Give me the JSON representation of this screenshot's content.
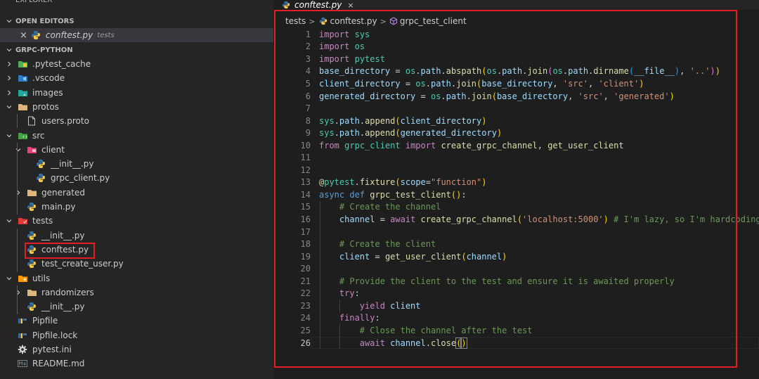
{
  "explorer": {
    "title": "EXPLORER",
    "more": "···",
    "open_editors_label": "OPEN EDITORS",
    "open_editor": {
      "close": "×",
      "name": "conftest.py",
      "folder": "tests"
    },
    "project_label": "GRPC-PYTHON",
    "tree": [
      {
        "label": ".pytest_cache",
        "kind": "folder",
        "expanded": false,
        "icon": "pytest-folder-icon"
      },
      {
        "label": ".vscode",
        "kind": "folder",
        "expanded": false,
        "icon": "vscode-folder-icon"
      },
      {
        "label": "images",
        "kind": "folder",
        "expanded": false,
        "icon": "images-folder-icon"
      },
      {
        "label": "protos",
        "kind": "folder",
        "expanded": true,
        "icon": "folder-icon"
      },
      {
        "label": "users.proto",
        "kind": "file",
        "icon": "file-icon"
      },
      {
        "label": "src",
        "kind": "folder",
        "expanded": true,
        "icon": "src-folder-icon"
      },
      {
        "label": "client",
        "kind": "folder",
        "expanded": true,
        "icon": "client-folder-icon"
      },
      {
        "label": "__init__.py",
        "kind": "file",
        "icon": "python-icon"
      },
      {
        "label": "grpc_client.py",
        "kind": "file",
        "icon": "python-icon"
      },
      {
        "label": "generated",
        "kind": "folder",
        "expanded": false,
        "icon": "folder-icon"
      },
      {
        "label": "main.py",
        "kind": "file",
        "icon": "python-icon"
      },
      {
        "label": "tests",
        "kind": "folder",
        "expanded": true,
        "icon": "tests-folder-icon"
      },
      {
        "label": "__init__.py",
        "kind": "file",
        "icon": "python-icon"
      },
      {
        "label": "conftest.py",
        "kind": "file",
        "icon": "python-icon"
      },
      {
        "label": "test_create_user.py",
        "kind": "file",
        "icon": "python-icon"
      },
      {
        "label": "utils",
        "kind": "folder",
        "expanded": true,
        "icon": "utils-folder-icon"
      },
      {
        "label": "randomizers",
        "kind": "folder",
        "expanded": false,
        "icon": "folder-icon"
      },
      {
        "label": "__init__.py",
        "kind": "file",
        "icon": "python-icon"
      },
      {
        "label": "Pipfile",
        "kind": "file",
        "icon": "pipfile-icon"
      },
      {
        "label": "Pipfile.lock",
        "kind": "file",
        "icon": "pipfile-icon"
      },
      {
        "label": "pytest.ini",
        "kind": "file",
        "icon": "gear-icon"
      },
      {
        "label": "README.md",
        "kind": "file",
        "icon": "markdown-icon"
      }
    ]
  },
  "tab": {
    "name": "conftest.py",
    "close": "×"
  },
  "breadcrumb": {
    "folder": "tests",
    "file": "conftest.py",
    "symbol": "grpc_test_client"
  },
  "editor": {
    "active_line": 26,
    "lines": [
      [
        [
          "k-ctrl",
          "import"
        ],
        [
          "k-pl",
          " "
        ],
        [
          "k-cls",
          "sys"
        ]
      ],
      [
        [
          "k-ctrl",
          "import"
        ],
        [
          "k-pl",
          " "
        ],
        [
          "k-cls",
          "os"
        ]
      ],
      [
        [
          "k-ctrl",
          "import"
        ],
        [
          "k-pl",
          " "
        ],
        [
          "k-cls",
          "pytest"
        ]
      ],
      [
        [
          "k-var",
          "base_directory"
        ],
        [
          "k-pl",
          " = "
        ],
        [
          "k-cls",
          "os"
        ],
        [
          "k-pl",
          "."
        ],
        [
          "k-var",
          "path"
        ],
        [
          "k-pl",
          "."
        ],
        [
          "k-fn",
          "abspath"
        ],
        [
          "k-par",
          "("
        ],
        [
          "k-cls",
          "os"
        ],
        [
          "k-pl",
          "."
        ],
        [
          "k-var",
          "path"
        ],
        [
          "k-pl",
          "."
        ],
        [
          "k-fn",
          "join"
        ],
        [
          "k-par2",
          "("
        ],
        [
          "k-cls",
          "os"
        ],
        [
          "k-pl",
          "."
        ],
        [
          "k-var",
          "path"
        ],
        [
          "k-pl",
          "."
        ],
        [
          "k-fn",
          "dirname"
        ],
        [
          "k-par3",
          "("
        ],
        [
          "k-var",
          "__file__"
        ],
        [
          "k-par3",
          ")"
        ],
        [
          "k-pl",
          ", "
        ],
        [
          "k-str",
          "'..'"
        ],
        [
          "k-par2",
          ")"
        ],
        [
          "k-par",
          ")"
        ]
      ],
      [
        [
          "k-var",
          "client_directory"
        ],
        [
          "k-pl",
          " = "
        ],
        [
          "k-cls",
          "os"
        ],
        [
          "k-pl",
          "."
        ],
        [
          "k-var",
          "path"
        ],
        [
          "k-pl",
          "."
        ],
        [
          "k-fn",
          "join"
        ],
        [
          "k-par",
          "("
        ],
        [
          "k-var",
          "base_directory"
        ],
        [
          "k-pl",
          ", "
        ],
        [
          "k-str",
          "'src'"
        ],
        [
          "k-pl",
          ", "
        ],
        [
          "k-str",
          "'client'"
        ],
        [
          "k-par",
          ")"
        ]
      ],
      [
        [
          "k-var",
          "generated_directory"
        ],
        [
          "k-pl",
          " = "
        ],
        [
          "k-cls",
          "os"
        ],
        [
          "k-pl",
          "."
        ],
        [
          "k-var",
          "path"
        ],
        [
          "k-pl",
          "."
        ],
        [
          "k-fn",
          "join"
        ],
        [
          "k-par",
          "("
        ],
        [
          "k-var",
          "base_directory"
        ],
        [
          "k-pl",
          ", "
        ],
        [
          "k-str",
          "'src'"
        ],
        [
          "k-pl",
          ", "
        ],
        [
          "k-str",
          "'generated'"
        ],
        [
          "k-par",
          ")"
        ]
      ],
      [],
      [
        [
          "k-cls",
          "sys"
        ],
        [
          "k-pl",
          "."
        ],
        [
          "k-var",
          "path"
        ],
        [
          "k-pl",
          "."
        ],
        [
          "k-fn",
          "append"
        ],
        [
          "k-par",
          "("
        ],
        [
          "k-var",
          "client_directory"
        ],
        [
          "k-par",
          ")"
        ]
      ],
      [
        [
          "k-cls",
          "sys"
        ],
        [
          "k-pl",
          "."
        ],
        [
          "k-var",
          "path"
        ],
        [
          "k-pl",
          "."
        ],
        [
          "k-fn",
          "append"
        ],
        [
          "k-par",
          "("
        ],
        [
          "k-var",
          "generated_directory"
        ],
        [
          "k-par",
          ")"
        ]
      ],
      [
        [
          "k-ctrl",
          "from"
        ],
        [
          "k-pl",
          " "
        ],
        [
          "k-cls",
          "grpc_client"
        ],
        [
          "k-pl",
          " "
        ],
        [
          "k-ctrl",
          "import"
        ],
        [
          "k-pl",
          " "
        ],
        [
          "k-fn",
          "create_grpc_channel"
        ],
        [
          "k-pl",
          ", "
        ],
        [
          "k-fn",
          "get_user_client"
        ]
      ],
      [],
      [],
      [
        [
          "k-fn",
          "@"
        ],
        [
          "k-cls",
          "pytest"
        ],
        [
          "k-pl",
          "."
        ],
        [
          "k-fn",
          "fixture"
        ],
        [
          "k-par",
          "("
        ],
        [
          "k-var",
          "scope"
        ],
        [
          "k-pl",
          "="
        ],
        [
          "k-str",
          "\"function\""
        ],
        [
          "k-par",
          ")"
        ]
      ],
      [
        [
          "k-kw",
          "async"
        ],
        [
          "k-pl",
          " "
        ],
        [
          "k-kw",
          "def"
        ],
        [
          "k-pl",
          " "
        ],
        [
          "k-fn",
          "grpc_test_client"
        ],
        [
          "k-par",
          "("
        ],
        [
          "k-par",
          ")"
        ],
        [
          "k-pl",
          ":"
        ]
      ],
      [
        [
          "k-pl",
          "    "
        ],
        [
          "k-com",
          "# Create the channel"
        ]
      ],
      [
        [
          "k-pl",
          "    "
        ],
        [
          "k-var",
          "channel"
        ],
        [
          "k-pl",
          " = "
        ],
        [
          "k-ctrl",
          "await"
        ],
        [
          "k-pl",
          " "
        ],
        [
          "k-fn",
          "create_grpc_channel"
        ],
        [
          "k-par",
          "("
        ],
        [
          "k-str",
          "'localhost:5000'"
        ],
        [
          "k-par",
          ")"
        ],
        [
          "k-pl",
          " "
        ],
        [
          "k-com",
          "# I'm lazy, so I'm hardcoding"
        ]
      ],
      [],
      [
        [
          "k-pl",
          "    "
        ],
        [
          "k-com",
          "# Create the client"
        ]
      ],
      [
        [
          "k-pl",
          "    "
        ],
        [
          "k-var",
          "client"
        ],
        [
          "k-pl",
          " = "
        ],
        [
          "k-fn",
          "get_user_client"
        ],
        [
          "k-par",
          "("
        ],
        [
          "k-var",
          "channel"
        ],
        [
          "k-par",
          ")"
        ]
      ],
      [],
      [
        [
          "k-pl",
          "    "
        ],
        [
          "k-com",
          "# Provide the client to the test and ensure it is awaited properly"
        ]
      ],
      [
        [
          "k-pl",
          "    "
        ],
        [
          "k-ctrl",
          "try"
        ],
        [
          "k-pl",
          ":"
        ]
      ],
      [
        [
          "k-pl",
          "        "
        ],
        [
          "k-ctrl",
          "yield"
        ],
        [
          "k-pl",
          " "
        ],
        [
          "k-var",
          "client"
        ]
      ],
      [
        [
          "k-pl",
          "    "
        ],
        [
          "k-ctrl",
          "finally"
        ],
        [
          "k-pl",
          ":"
        ]
      ],
      [
        [
          "k-pl",
          "        "
        ],
        [
          "k-com",
          "# Close the channel after the test"
        ]
      ],
      [
        [
          "k-pl",
          "        "
        ],
        [
          "k-ctrl",
          "await"
        ],
        [
          "k-pl",
          " "
        ],
        [
          "k-var",
          "channel"
        ],
        [
          "k-pl",
          "."
        ],
        [
          "k-fn",
          "close"
        ],
        [
          "k-par",
          "("
        ],
        [
          "k-par",
          ")"
        ]
      ]
    ]
  },
  "colors": {
    "annotation": "#e31e24",
    "python_blue": "#3572a5",
    "python_yellow": "#f7c948",
    "folder": "#dcb67a"
  }
}
